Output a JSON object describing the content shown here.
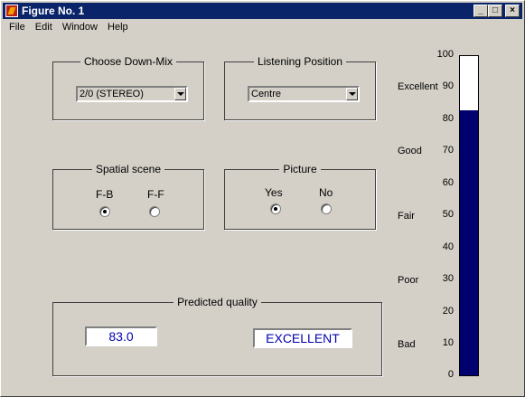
{
  "window": {
    "title": "Figure No. 1"
  },
  "menu": [
    "File",
    "Edit",
    "Window",
    "Help"
  ],
  "downmix": {
    "legend": "Choose Down-Mix",
    "value": "2/0 (STEREO)"
  },
  "position": {
    "legend": "Listening Position",
    "value": "Centre"
  },
  "spatial": {
    "legend": "Spatial scene",
    "opt1": "F-B",
    "opt2": "F-F",
    "selected": "F-B"
  },
  "picture": {
    "legend": "Picture",
    "opt1": "Yes",
    "opt2": "No",
    "selected": "Yes"
  },
  "predicted": {
    "legend": "Predicted quality",
    "value": "83.0",
    "label": "EXCELLENT"
  },
  "scale": {
    "ticks": [
      "100",
      "90",
      "80",
      "70",
      "60",
      "50",
      "40",
      "30",
      "20",
      "10",
      "0"
    ],
    "labels": [
      "Excellent",
      "Good",
      "Fair",
      "Poor",
      "Bad"
    ],
    "bar_value": 83,
    "bar_max": 100,
    "bar_color": "#00006e"
  }
}
